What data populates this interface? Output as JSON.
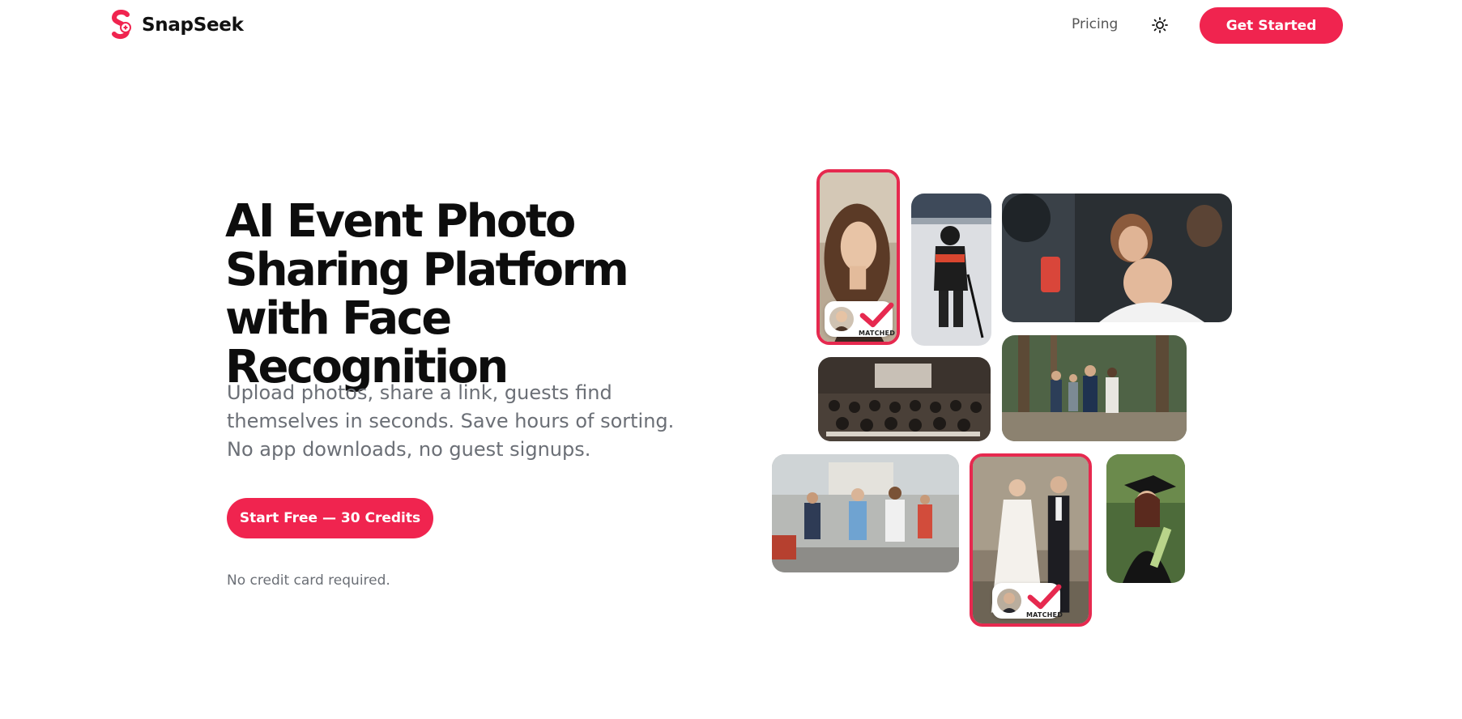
{
  "header": {
    "brand_name": "SnapSeek",
    "nav_pricing": "Pricing",
    "cta_label": "Get Started"
  },
  "hero": {
    "title": "AI Event Photo Sharing Platform with Face Recognition",
    "subtitle": "Upload photos, share a link, guests find themselves in seconds. Save hours of sorting. No app downloads, no guest signups.",
    "cta_label": "Start Free — 30 Credits",
    "note": "No credit card required."
  },
  "collage": {
    "badge_text": "MATCHED",
    "photos": [
      {
        "subject": "woman-portrait",
        "matched": true
      },
      {
        "subject": "hockey-player",
        "matched": false
      },
      {
        "subject": "party-crowd",
        "matched": false
      },
      {
        "subject": "conference-audience",
        "matched": false
      },
      {
        "subject": "forest-hikers",
        "matched": false
      },
      {
        "subject": "marathon-runners",
        "matched": false
      },
      {
        "subject": "wedding-couple",
        "matched": true
      },
      {
        "subject": "graduate",
        "matched": false
      }
    ]
  },
  "colors": {
    "accent": "#f0244f",
    "text_dark": "#0d0d0d",
    "text_muted": "#6b6f76"
  },
  "icons": {
    "logo": "snapseek-logo-icon",
    "theme": "sun-icon",
    "check": "check-icon"
  }
}
